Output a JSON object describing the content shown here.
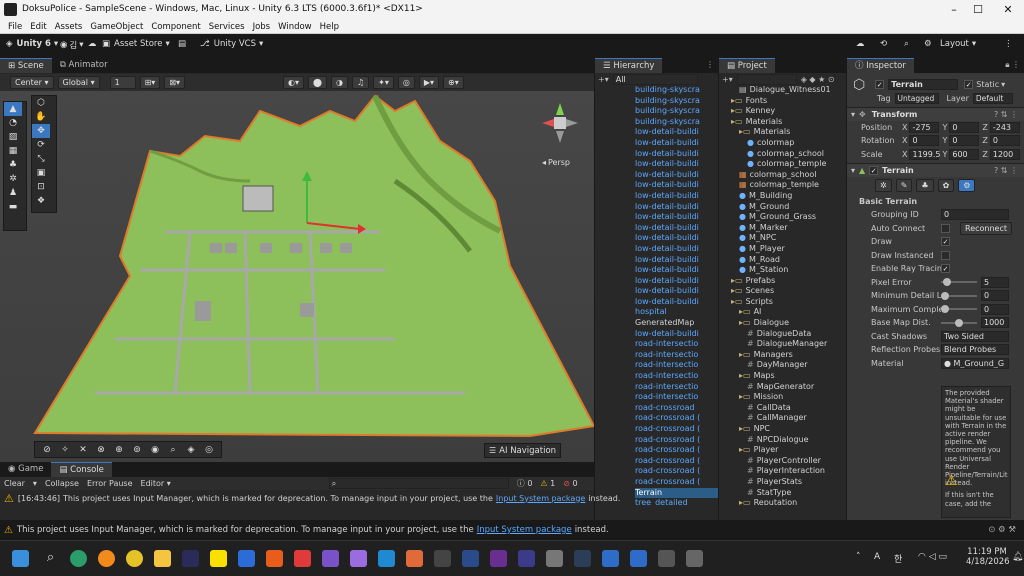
{
  "window": {
    "title": "DoksuPolice - SampleScene - Windows, Mac, Linux - Unity 6.3 LTS (6000.3.6f1)* <DX11>",
    "controls": [
      "–",
      "☐",
      "✕"
    ]
  },
  "menu": [
    "File",
    "Edit",
    "Assets",
    "GameObject",
    "Component",
    "Services",
    "Jobs",
    "Window",
    "Help"
  ],
  "toolbar": {
    "unity_label": "Unity 6",
    "account": "김",
    "asset_store": "Asset Store",
    "vcs": "Unity VCS",
    "layout": "Layout"
  },
  "scene": {
    "tabs": [
      "Scene",
      "Animator"
    ],
    "pivot": "Center",
    "space": "Global",
    "snap_value": "1",
    "persp_label": "Persp",
    "ai_navigation": "AI Navigation"
  },
  "hierarchy": {
    "tab": "Hierarchy",
    "search_placeholder": "All",
    "items": [
      "building-skyscra",
      "building-skyscra",
      "building-skyscra",
      "building-skyscra",
      "low-detail-buildi",
      "low-detail-buildi",
      "low-detail-buildi",
      "low-detail-buildi",
      "low-detail-buildi",
      "low-detail-buildi",
      "low-detail-buildi",
      "low-detail-buildi",
      "low-detail-buildi",
      "low-detail-buildi",
      "low-detail-buildi",
      "low-detail-buildi",
      "low-detail-buildi",
      "low-detail-buildi",
      "low-detail-buildi",
      "low-detail-buildi",
      "low-detail-buildi",
      "hospital",
      "GeneratedMap",
      "low-detail-buildi",
      "road-intersectio",
      "road-intersectio",
      "road-intersectio",
      "road-intersectio",
      "road-intersectio",
      "road-intersectio",
      "road-crossroad",
      "road-crossroad (",
      "road-crossroad (",
      "road-crossroad (",
      "road-crossroad (",
      "road-crossroad (",
      "road-crossroad (",
      "road-crossroad (",
      "Terrain",
      "tree_detailed"
    ]
  },
  "project": {
    "tab": "Project",
    "items": [
      {
        "label": "Dialogue_Witness01",
        "indent": 2,
        "type": "file"
      },
      {
        "label": "Fonts",
        "indent": 1,
        "type": "folder"
      },
      {
        "label": "Kenney",
        "indent": 1,
        "type": "folder"
      },
      {
        "label": "Materials",
        "indent": 1,
        "type": "folder"
      },
      {
        "label": "Materials",
        "indent": 2,
        "type": "folder"
      },
      {
        "label": "colormap",
        "indent": 3,
        "type": "mat"
      },
      {
        "label": "colormap_school",
        "indent": 3,
        "type": "mat"
      },
      {
        "label": "colormap_temple",
        "indent": 3,
        "type": "mat"
      },
      {
        "label": "colormap_school",
        "indent": 2,
        "type": "tex"
      },
      {
        "label": "colormap_temple",
        "indent": 2,
        "type": "tex"
      },
      {
        "label": "M_Building",
        "indent": 2,
        "type": "mat"
      },
      {
        "label": "M_Ground",
        "indent": 2,
        "type": "mat"
      },
      {
        "label": "M_Ground_Grass",
        "indent": 2,
        "type": "mat"
      },
      {
        "label": "M_Marker",
        "indent": 2,
        "type": "mat"
      },
      {
        "label": "M_NPC",
        "indent": 2,
        "type": "mat"
      },
      {
        "label": "M_Player",
        "indent": 2,
        "type": "mat"
      },
      {
        "label": "M_Road",
        "indent": 2,
        "type": "mat"
      },
      {
        "label": "M_Station",
        "indent": 2,
        "type": "mat"
      },
      {
        "label": "Prefabs",
        "indent": 1,
        "type": "folder"
      },
      {
        "label": "Scenes",
        "indent": 1,
        "type": "folder"
      },
      {
        "label": "Scripts",
        "indent": 1,
        "type": "folder"
      },
      {
        "label": "AI",
        "indent": 2,
        "type": "folder"
      },
      {
        "label": "Dialogue",
        "indent": 2,
        "type": "folder"
      },
      {
        "label": "DialogueData",
        "indent": 3,
        "type": "script"
      },
      {
        "label": "DialogueManager",
        "indent": 3,
        "type": "script"
      },
      {
        "label": "Managers",
        "indent": 2,
        "type": "folder"
      },
      {
        "label": "DayManager",
        "indent": 3,
        "type": "script"
      },
      {
        "label": "Maps",
        "indent": 2,
        "type": "folder"
      },
      {
        "label": "MapGenerator",
        "indent": 3,
        "type": "script"
      },
      {
        "label": "Mission",
        "indent": 2,
        "type": "folder"
      },
      {
        "label": "CallData",
        "indent": 3,
        "type": "script"
      },
      {
        "label": "CallManager",
        "indent": 3,
        "type": "script"
      },
      {
        "label": "NPC",
        "indent": 2,
        "type": "folder"
      },
      {
        "label": "NPCDialogue",
        "indent": 3,
        "type": "script"
      },
      {
        "label": "Player",
        "indent": 2,
        "type": "folder"
      },
      {
        "label": "PlayerController",
        "indent": 3,
        "type": "script"
      },
      {
        "label": "PlayerInteraction",
        "indent": 3,
        "type": "script"
      },
      {
        "label": "PlayerStats",
        "indent": 3,
        "type": "script"
      },
      {
        "label": "StatType",
        "indent": 3,
        "type": "script"
      },
      {
        "label": "Reputation",
        "indent": 2,
        "type": "folder"
      }
    ]
  },
  "inspector": {
    "tab": "Inspector",
    "object_name": "Terrain",
    "static_label": "Static",
    "tag_label": "Tag",
    "tag_value": "Untagged",
    "layer_label": "Layer",
    "layer_value": "Default",
    "transform": {
      "title": "Transform",
      "rows": [
        {
          "label": "Position",
          "x": "-275",
          "y": "0",
          "z": "-243"
        },
        {
          "label": "Rotation",
          "x": "0",
          "y": "0",
          "z": "0"
        },
        {
          "label": "Scale",
          "x": "1199.5",
          "y": "600",
          "z": "1200"
        }
      ]
    },
    "terrain": {
      "title": "Terrain",
      "section": "Basic Terrain",
      "grouping_id_label": "Grouping ID",
      "grouping_id": "0",
      "auto_connect": "Auto Connect",
      "reconnect": "Reconnect",
      "draw": "Draw",
      "draw_instanced": "Draw Instanced",
      "ray_tracing": "Enable Ray Tracing",
      "pixel_error_label": "Pixel Error",
      "pixel_error": "5",
      "min_detail_label": "Minimum Detail Lim",
      "min_detail": "0",
      "max_complex_label": "Maximum Complex",
      "max_complex": "0",
      "base_map_label": "Base Map Dist.",
      "base_map": "1000",
      "cast_shadows_label": "Cast Shadows",
      "cast_shadows": "Two Sided",
      "reflection_label": "Reflection Probes",
      "reflection": "Blend Probes",
      "material_label": "Material",
      "material": "M_Ground_G",
      "warning": "The provided Material's shader might be unsuitable for use with Terrain in the active render pipeline. We recommend you use Universal Render Pipeline/Terrain/Lit instead.",
      "warning2": "If this isn't the case, add the"
    }
  },
  "console": {
    "tabs": [
      "Game",
      "Console"
    ],
    "clear": "Clear",
    "collapse": "Collapse",
    "error_pause": "Error Pause",
    "editor": "Editor",
    "count_errors": "0",
    "count_warnings": "1",
    "count_logs": "0",
    "log_time": "[16:43:46]",
    "log_text": "This project uses Input Manager, which is marked for deprecation. To manage input in your project, use the",
    "log_link": "Input System package",
    "log_tail": "instead."
  },
  "status": {
    "text": "This project uses Input Manager, which is marked for deprecation. To manage input in your project, use the",
    "link": "Input System package",
    "tail": "instead."
  },
  "taskbar": {
    "ime": "한",
    "ime2": "A",
    "time": "11:19 PM",
    "date": "4/18/2026"
  },
  "colors": {
    "accent": "#3c78c0",
    "terrain": "#8dbf5a",
    "link": "#5ca8ff",
    "warning": "#f0b400"
  }
}
